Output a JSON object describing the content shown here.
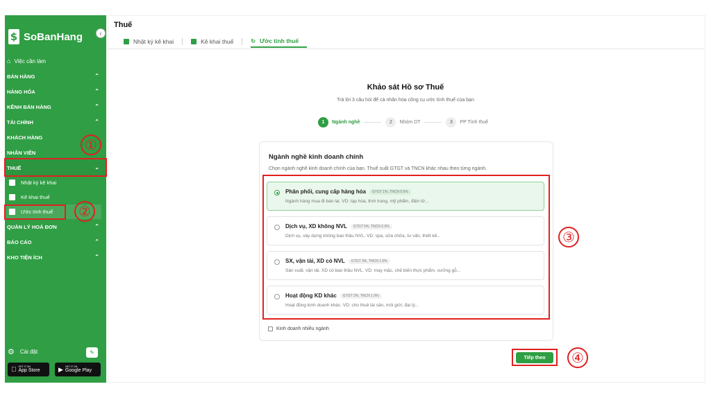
{
  "app": {
    "name": "SoBanHang",
    "logo_glyph": "$",
    "brand_color": "#2f9e44",
    "annotation_color": "#e02020"
  },
  "sidebar": {
    "collapse_icon": "chevron-left-icon",
    "todo": {
      "label": "Việc cần làm",
      "icon": "home-icon"
    },
    "sections": [
      {
        "label": "BÁN HÀNG",
        "chevron": "up"
      },
      {
        "label": "HÀNG HÓA",
        "chevron": "up"
      },
      {
        "label": "KÊNH BÁN HÀNG",
        "chevron": "up"
      },
      {
        "label": "TÀI CHÍNH",
        "chevron": "up"
      },
      {
        "label": "KHÁCH HÀNG",
        "chevron": ""
      },
      {
        "label": "NHÂN VIÊN",
        "chevron": ""
      },
      {
        "label": "THUẾ",
        "chevron": "down"
      }
    ],
    "tax_subitems": [
      {
        "label": "Nhật ký kê khai"
      },
      {
        "label": "Kê khai thuế"
      },
      {
        "label": "Ước tính thuế"
      }
    ],
    "sections_after": [
      {
        "label": "QUẢN LÝ HOÁ ĐƠN",
        "chevron": "up"
      },
      {
        "label": "BÁO CÁO",
        "chevron": "up"
      },
      {
        "label": "KHO TIỆN ÍCH",
        "chevron": "up"
      }
    ],
    "settings_label": "Cài đặt",
    "appstore": {
      "small": "GET IT ON",
      "big": "App Store"
    },
    "googleplay": {
      "small": "GET IT ON",
      "big": "Google Play"
    }
  },
  "header": {
    "title": "Thuế",
    "tabs": [
      {
        "label": "Nhật ký kê khai"
      },
      {
        "label": "Kê khai thuế"
      },
      {
        "label": "Ước tính thuế"
      }
    ]
  },
  "survey": {
    "title": "Khảo sát Hồ sơ Thuế",
    "subtitle": "Trả lời 3 câu hỏi để cá nhân hóa công cụ ước tính thuế của bạn",
    "steps": [
      {
        "num": "1",
        "label": "Ngành nghề"
      },
      {
        "num": "2",
        "label": "Nhóm DT"
      },
      {
        "num": "3",
        "label": "PP Tính thuế"
      }
    ],
    "card_title": "Ngành nghề kinh doanh chính",
    "card_desc": "Chọn ngành nghề kinh doanh chính của bạn. Thuế suất GTGT và TNCN khác nhau theo từng ngành.",
    "options": [
      {
        "name": "Phân phối, cung cấp hàng hóa",
        "badge": "GTGT 1%, TNCN 0.5%",
        "desc": "Ngành hàng mua đi bán lại. VD: tạp hóa, thời trang, mỹ phẩm, điện tử..."
      },
      {
        "name": "Dịch vụ, XD không NVL",
        "badge": "GTGT 5%, TNCN 2.0%",
        "desc": "Dịch vụ, xây dựng không bao thầu NVL. VD: spa, sửa chữa, tư vấn, thiết kế..."
      },
      {
        "name": "SX, vận tải, XD có NVL",
        "badge": "GTGT 3%, TNCN 1.5%",
        "desc": "Sản xuất, vận tải, XD có bao thầu NVL. VD: may mặc, chế biến thực phẩm, xưởng gỗ..."
      },
      {
        "name": "Hoạt động KD khác",
        "badge": "GTGT 2%, TNCN 1.0%",
        "desc": "Hoạt động kinh doanh khác. VD: cho thuê tài sản, môi giới, đại lý..."
      }
    ],
    "selected_option": 0,
    "multi_label": "Kinh doanh nhiều ngành",
    "next_label": "Tiếp theo"
  },
  "annotations": [
    "①",
    "②",
    "③",
    "④"
  ]
}
